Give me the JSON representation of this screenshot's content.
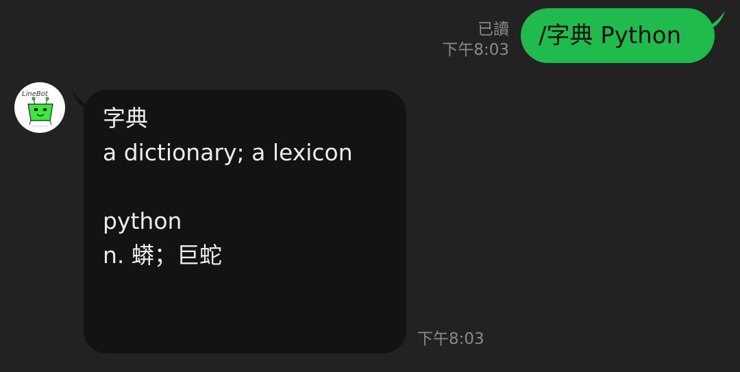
{
  "colors": {
    "background": "#222222",
    "outgoing_bubble": "#1fbc4d",
    "incoming_bubble": "#131313",
    "meta_text": "#8a8a8a",
    "message_text": "#ededed"
  },
  "outgoing": {
    "read_status": "已讀",
    "time": "下午8:03",
    "text": "/字典 Python"
  },
  "incoming": {
    "avatar": {
      "icon": "linebot-robot-avatar",
      "logo_text": "LineBot"
    },
    "lines": [
      "字典",
      "a dictionary; a lexicon",
      "python",
      "n. 蟒；巨蛇"
    ],
    "time": "下午8:03"
  }
}
